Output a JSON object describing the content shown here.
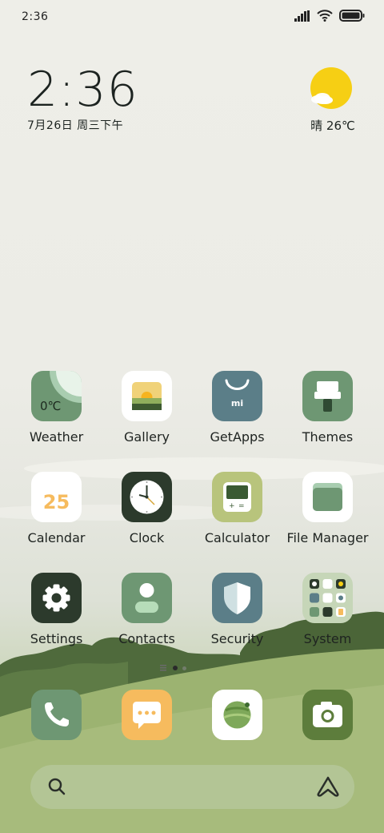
{
  "status_bar": {
    "time": "2:36",
    "signal_icon": "signal-icon",
    "wifi_icon": "wifi-icon",
    "battery_icon": "battery-icon"
  },
  "clock_widget": {
    "time": "2:36",
    "date": "7月26日 周三下午"
  },
  "weather_widget": {
    "condition_temp": "晴 26℃",
    "icon": "sun-cloud-icon"
  },
  "apps": [
    {
      "label": "Weather",
      "temp": "0℃"
    },
    {
      "label": "Gallery"
    },
    {
      "label": "GetApps",
      "badge": "mi"
    },
    {
      "label": "Themes"
    },
    {
      "label": "Calendar",
      "day": "25"
    },
    {
      "label": "Clock"
    },
    {
      "label": "Calculator"
    },
    {
      "label": "File Manager"
    },
    {
      "label": "Settings"
    },
    {
      "label": "Contacts"
    },
    {
      "label": "Security"
    },
    {
      "label": "System"
    }
  ],
  "dock": [
    {
      "name": "phone",
      "icon": "phone-icon"
    },
    {
      "name": "messages",
      "icon": "message-icon"
    },
    {
      "name": "browser",
      "icon": "planet-icon"
    },
    {
      "name": "camera",
      "icon": "camera-icon"
    }
  ],
  "search_bar": {
    "search_icon": "search-icon",
    "assistant_icon": "assistant-icon"
  },
  "pages": {
    "current": 2,
    "total": 3
  },
  "colors": {
    "sage": "#6e9773",
    "slate": "#5b7e88",
    "dark": "#2c3a2c",
    "yellow": "#f6cf14",
    "orange": "#f6bb5e",
    "olive": "#5d7d3c",
    "lime": "#b8c47c"
  }
}
